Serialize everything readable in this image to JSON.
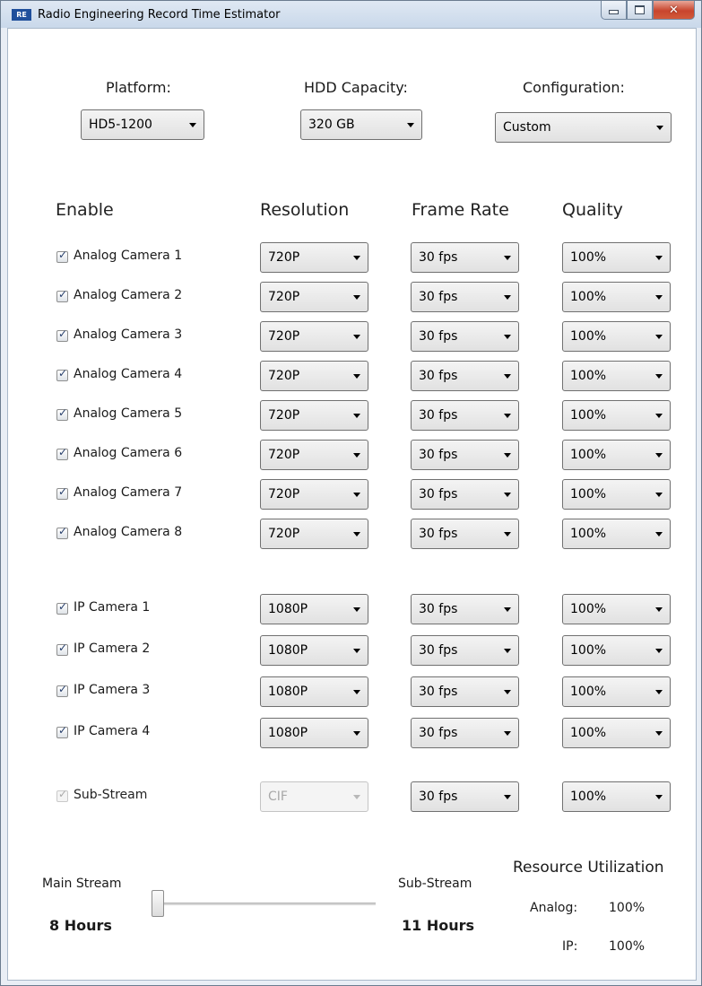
{
  "window": {
    "title": "Radio Engineering Record Time Estimator",
    "logo_text": "RE"
  },
  "top": {
    "platform": {
      "label": "Platform:",
      "value": "HD5-1200"
    },
    "hdd": {
      "label": "HDD Capacity:",
      "value": "320 GB"
    },
    "config": {
      "label": "Configuration:",
      "value": "Custom"
    }
  },
  "columns": {
    "enable": "Enable",
    "resolution": "Resolution",
    "frame_rate": "Frame Rate",
    "quality": "Quality"
  },
  "cameras": [
    {
      "label": "Analog Camera 1",
      "resolution": "720P",
      "frame_rate": "30 fps",
      "quality": "100%",
      "enabled": true
    },
    {
      "label": "Analog Camera 2",
      "resolution": "720P",
      "frame_rate": "30 fps",
      "quality": "100%",
      "enabled": true
    },
    {
      "label": "Analog Camera 3",
      "resolution": "720P",
      "frame_rate": "30 fps",
      "quality": "100%",
      "enabled": true
    },
    {
      "label": "Analog Camera 4",
      "resolution": "720P",
      "frame_rate": "30 fps",
      "quality": "100%",
      "enabled": true
    },
    {
      "label": "Analog Camera 5",
      "resolution": "720P",
      "frame_rate": "30 fps",
      "quality": "100%",
      "enabled": true
    },
    {
      "label": "Analog Camera 6",
      "resolution": "720P",
      "frame_rate": "30 fps",
      "quality": "100%",
      "enabled": true
    },
    {
      "label": "Analog Camera 7",
      "resolution": "720P",
      "frame_rate": "30 fps",
      "quality": "100%",
      "enabled": true
    },
    {
      "label": "Analog Camera 8",
      "resolution": "720P",
      "frame_rate": "30 fps",
      "quality": "100%",
      "enabled": true
    },
    {
      "label": "IP Camera 1",
      "resolution": "1080P",
      "frame_rate": "30 fps",
      "quality": "100%",
      "enabled": true
    },
    {
      "label": "IP Camera 2",
      "resolution": "1080P",
      "frame_rate": "30 fps",
      "quality": "100%",
      "enabled": true
    },
    {
      "label": "IP Camera 3",
      "resolution": "1080P",
      "frame_rate": "30 fps",
      "quality": "100%",
      "enabled": true
    },
    {
      "label": "IP Camera 4",
      "resolution": "1080P",
      "frame_rate": "30 fps",
      "quality": "100%",
      "enabled": true
    }
  ],
  "substream": {
    "label": "Sub-Stream",
    "resolution": "CIF",
    "frame_rate": "30 fps",
    "quality": "100%",
    "enabled": true,
    "disabled": true
  },
  "bottom": {
    "main_label": "Main Stream",
    "main_hours": "8 Hours",
    "sub_label": "Sub-Stream",
    "sub_hours": "11 Hours",
    "slider_value": 0,
    "resource_title": "Resource Utilization",
    "analog_label": "Analog:",
    "analog_value": "100%",
    "ip_label": "IP:",
    "ip_value": "100%"
  },
  "colors": {
    "title_bar": "#c9d8ea",
    "close_button": "#c8452d",
    "logo": "#1f4f9c"
  },
  "icons": [
    "minimize-icon",
    "maximize-icon",
    "close-icon",
    "dropdown-arrow-icon",
    "checkbox-check-icon"
  ]
}
